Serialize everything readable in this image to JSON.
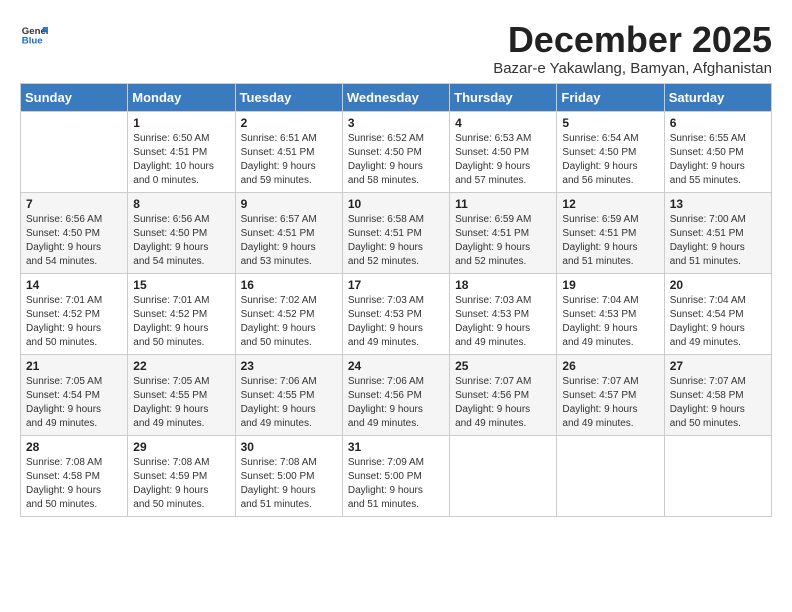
{
  "logo": {
    "general": "General",
    "blue": "Blue"
  },
  "title": "December 2025",
  "subtitle": "Bazar-e Yakawlang, Bamyan, Afghanistan",
  "headers": [
    "Sunday",
    "Monday",
    "Tuesday",
    "Wednesday",
    "Thursday",
    "Friday",
    "Saturday"
  ],
  "weeks": [
    [
      {
        "day": "",
        "info": ""
      },
      {
        "day": "1",
        "info": "Sunrise: 6:50 AM\nSunset: 4:51 PM\nDaylight: 10 hours\nand 0 minutes."
      },
      {
        "day": "2",
        "info": "Sunrise: 6:51 AM\nSunset: 4:51 PM\nDaylight: 9 hours\nand 59 minutes."
      },
      {
        "day": "3",
        "info": "Sunrise: 6:52 AM\nSunset: 4:50 PM\nDaylight: 9 hours\nand 58 minutes."
      },
      {
        "day": "4",
        "info": "Sunrise: 6:53 AM\nSunset: 4:50 PM\nDaylight: 9 hours\nand 57 minutes."
      },
      {
        "day": "5",
        "info": "Sunrise: 6:54 AM\nSunset: 4:50 PM\nDaylight: 9 hours\nand 56 minutes."
      },
      {
        "day": "6",
        "info": "Sunrise: 6:55 AM\nSunset: 4:50 PM\nDaylight: 9 hours\nand 55 minutes."
      }
    ],
    [
      {
        "day": "7",
        "info": "Sunrise: 6:56 AM\nSunset: 4:50 PM\nDaylight: 9 hours\nand 54 minutes."
      },
      {
        "day": "8",
        "info": "Sunrise: 6:56 AM\nSunset: 4:50 PM\nDaylight: 9 hours\nand 54 minutes."
      },
      {
        "day": "9",
        "info": "Sunrise: 6:57 AM\nSunset: 4:51 PM\nDaylight: 9 hours\nand 53 minutes."
      },
      {
        "day": "10",
        "info": "Sunrise: 6:58 AM\nSunset: 4:51 PM\nDaylight: 9 hours\nand 52 minutes."
      },
      {
        "day": "11",
        "info": "Sunrise: 6:59 AM\nSunset: 4:51 PM\nDaylight: 9 hours\nand 52 minutes."
      },
      {
        "day": "12",
        "info": "Sunrise: 6:59 AM\nSunset: 4:51 PM\nDaylight: 9 hours\nand 51 minutes."
      },
      {
        "day": "13",
        "info": "Sunrise: 7:00 AM\nSunset: 4:51 PM\nDaylight: 9 hours\nand 51 minutes."
      }
    ],
    [
      {
        "day": "14",
        "info": "Sunrise: 7:01 AM\nSunset: 4:52 PM\nDaylight: 9 hours\nand 50 minutes."
      },
      {
        "day": "15",
        "info": "Sunrise: 7:01 AM\nSunset: 4:52 PM\nDaylight: 9 hours\nand 50 minutes."
      },
      {
        "day": "16",
        "info": "Sunrise: 7:02 AM\nSunset: 4:52 PM\nDaylight: 9 hours\nand 50 minutes."
      },
      {
        "day": "17",
        "info": "Sunrise: 7:03 AM\nSunset: 4:53 PM\nDaylight: 9 hours\nand 49 minutes."
      },
      {
        "day": "18",
        "info": "Sunrise: 7:03 AM\nSunset: 4:53 PM\nDaylight: 9 hours\nand 49 minutes."
      },
      {
        "day": "19",
        "info": "Sunrise: 7:04 AM\nSunset: 4:53 PM\nDaylight: 9 hours\nand 49 minutes."
      },
      {
        "day": "20",
        "info": "Sunrise: 7:04 AM\nSunset: 4:54 PM\nDaylight: 9 hours\nand 49 minutes."
      }
    ],
    [
      {
        "day": "21",
        "info": "Sunrise: 7:05 AM\nSunset: 4:54 PM\nDaylight: 9 hours\nand 49 minutes."
      },
      {
        "day": "22",
        "info": "Sunrise: 7:05 AM\nSunset: 4:55 PM\nDaylight: 9 hours\nand 49 minutes."
      },
      {
        "day": "23",
        "info": "Sunrise: 7:06 AM\nSunset: 4:55 PM\nDaylight: 9 hours\nand 49 minutes."
      },
      {
        "day": "24",
        "info": "Sunrise: 7:06 AM\nSunset: 4:56 PM\nDaylight: 9 hours\nand 49 minutes."
      },
      {
        "day": "25",
        "info": "Sunrise: 7:07 AM\nSunset: 4:56 PM\nDaylight: 9 hours\nand 49 minutes."
      },
      {
        "day": "26",
        "info": "Sunrise: 7:07 AM\nSunset: 4:57 PM\nDaylight: 9 hours\nand 49 minutes."
      },
      {
        "day": "27",
        "info": "Sunrise: 7:07 AM\nSunset: 4:58 PM\nDaylight: 9 hours\nand 50 minutes."
      }
    ],
    [
      {
        "day": "28",
        "info": "Sunrise: 7:08 AM\nSunset: 4:58 PM\nDaylight: 9 hours\nand 50 minutes."
      },
      {
        "day": "29",
        "info": "Sunrise: 7:08 AM\nSunset: 4:59 PM\nDaylight: 9 hours\nand 50 minutes."
      },
      {
        "day": "30",
        "info": "Sunrise: 7:08 AM\nSunset: 5:00 PM\nDaylight: 9 hours\nand 51 minutes."
      },
      {
        "day": "31",
        "info": "Sunrise: 7:09 AM\nSunset: 5:00 PM\nDaylight: 9 hours\nand 51 minutes."
      },
      {
        "day": "",
        "info": ""
      },
      {
        "day": "",
        "info": ""
      },
      {
        "day": "",
        "info": ""
      }
    ]
  ]
}
